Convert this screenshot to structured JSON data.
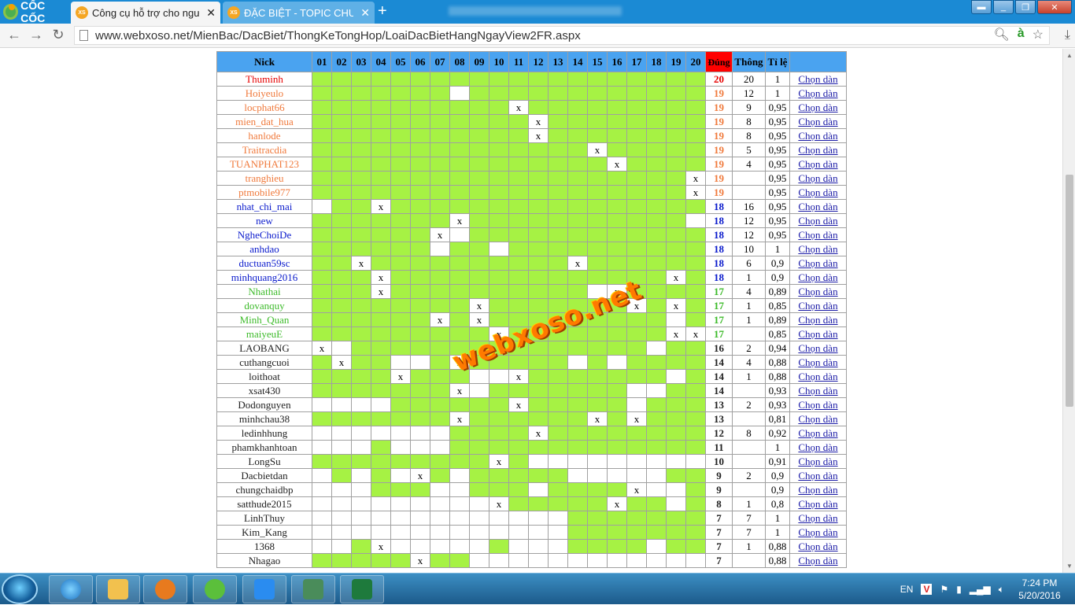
{
  "browser": {
    "name": "CỐC CỐC",
    "tabs": [
      {
        "title": "Công cụ hỗ trợ cho người",
        "icon": "XS",
        "active": true
      },
      {
        "title": "ĐẶC BIỆT - TOPIC CHUYÊN",
        "icon": "XS",
        "active": false
      }
    ],
    "url": "www.webxoso.net/MienBac/DacBiet/ThongKeTongHop/LoaiDacBietHangNgayView2FR.aspx"
  },
  "table": {
    "headers": {
      "nick": "Nick",
      "days": [
        "01",
        "02",
        "03",
        "04",
        "05",
        "06",
        "07",
        "08",
        "09",
        "10",
        "11",
        "12",
        "13",
        "14",
        "15",
        "16",
        "17",
        "18",
        "19",
        "20"
      ],
      "dung": "Đúng",
      "thong": "Thông",
      "tile": "Tỉ lệ"
    },
    "link_label": "Chọn dàn",
    "rows": [
      {
        "nick": "Thuminh",
        "color": "red",
        "pattern": "GGGGGGGGGGGGGGGGGGGG",
        "dung": "20",
        "thong": "20",
        "tile": "1"
      },
      {
        "nick": "Hoiyeulo",
        "color": "orange",
        "pattern": "GGGGGGGWGGGGGGGGGGGG",
        "dung": "19",
        "thong": "12",
        "tile": "1"
      },
      {
        "nick": "locphat66",
        "color": "orange",
        "pattern": "GGGGGGGGGGXGGGGGGGGG",
        "dung": "19",
        "thong": "9",
        "tile": "0,95"
      },
      {
        "nick": "mien_dat_hua",
        "color": "orange",
        "pattern": "GGGGGGGGGGGXGGGGGGGG",
        "dung": "19",
        "thong": "8",
        "tile": "0,95"
      },
      {
        "nick": "hanlode",
        "color": "orange",
        "pattern": "GGGGGGGGGGGXGGGGGGGG",
        "dung": "19",
        "thong": "8",
        "tile": "0,95"
      },
      {
        "nick": "Traitracdia",
        "color": "orange",
        "pattern": "GGGGGGGGGGGGGGXGGGGG",
        "dung": "19",
        "thong": "5",
        "tile": "0,95"
      },
      {
        "nick": "TUANPHAT123",
        "color": "orange",
        "pattern": "GGGGGGGGGGGGGGGXGGGG",
        "dung": "19",
        "thong": "4",
        "tile": "0,95"
      },
      {
        "nick": "tranghieu",
        "color": "orange",
        "pattern": "GGGGGGGGGGGGGGGGGGGX",
        "dung": "19",
        "thong": "",
        "tile": "0,95"
      },
      {
        "nick": "ptmobile977",
        "color": "orange",
        "pattern": "GGGGGGGGGGGGGGGGGGGX",
        "dung": "19",
        "thong": "",
        "tile": "0,95"
      },
      {
        "nick": "nhat_chi_mai",
        "color": "blue",
        "pattern": "WGGXGGGGGGGGGGGGGGGG",
        "dung": "18",
        "thong": "16",
        "tile": "0,95"
      },
      {
        "nick": "new",
        "color": "blue",
        "pattern": "GGGGGGGXGGGGGGGGGGGW",
        "dung": "18",
        "thong": "12",
        "tile": "0,95"
      },
      {
        "nick": "NgheChoiDe",
        "color": "blue",
        "pattern": "GGGGGGXWGGGGGGGGGGGG",
        "dung": "18",
        "thong": "12",
        "tile": "0,95"
      },
      {
        "nick": "anhdao",
        "color": "blue",
        "pattern": "GGGGGGWGGWGGGGGGGGGG",
        "dung": "18",
        "thong": "10",
        "tile": "1"
      },
      {
        "nick": "ductuan59sc",
        "color": "blue",
        "pattern": "GGXGGGGGGGGGGXGGGGGG",
        "dung": "18",
        "thong": "6",
        "tile": "0,9"
      },
      {
        "nick": "minhquang2016",
        "color": "blue",
        "pattern": "GGGXGGGGGGGGGGGGGGXG",
        "dung": "18",
        "thong": "1",
        "tile": "0,9"
      },
      {
        "nick": "Nhathai",
        "color": "green",
        "pattern": "GGGXGGGGGGGGGGWXGGGG",
        "dung": "17",
        "thong": "4",
        "tile": "0,89"
      },
      {
        "nick": "dovanquy",
        "color": "green",
        "pattern": "GGGGGGGGXGGGGGGGXGXG",
        "dung": "17",
        "thong": "1",
        "tile": "0,85"
      },
      {
        "nick": "Minh_Quan",
        "color": "green",
        "pattern": "GGGGGGXGXGGGGGGGGGWG",
        "dung": "17",
        "thong": "1",
        "tile": "0,89"
      },
      {
        "nick": "maiyeuE",
        "color": "green",
        "pattern": "GGGGGGGGGXGGGGGGGGXX",
        "dung": "17",
        "thong": "",
        "tile": "0,85"
      },
      {
        "nick": "LAOBANG",
        "color": "black",
        "pattern": "XWGGGGGGGGGGGGGGGWGG",
        "dung": "16",
        "thong": "2",
        "tile": "0,94"
      },
      {
        "nick": "cuthangcuoi",
        "color": "black",
        "pattern": "GXGGWWGXGGGGGWGWGGGG",
        "dung": "14",
        "thong": "4",
        "tile": "0,88"
      },
      {
        "nick": "loithoat",
        "color": "black",
        "pattern": "GGGGXGGGWWXGGGGGGGWG",
        "dung": "14",
        "thong": "1",
        "tile": "0,88"
      },
      {
        "nick": "xsat430",
        "color": "black",
        "pattern": "GGGGGGGXWGGGGGGGWWGG",
        "dung": "14",
        "thong": "",
        "tile": "0,93"
      },
      {
        "nick": "Dodonguyen",
        "color": "black",
        "pattern": "WWWWGGGGGGXGGGGGWGGG",
        "dung": "13",
        "thong": "2",
        "tile": "0,93"
      },
      {
        "nick": "minhchau38",
        "color": "black",
        "pattern": "GGGGGGGXGGGGGGXGXGGG",
        "dung": "13",
        "thong": "",
        "tile": "0,81"
      },
      {
        "nick": "ledinhhung",
        "color": "black",
        "pattern": "WWWWWWWGGGGXGGGGGGGG",
        "dung": "12",
        "thong": "8",
        "tile": "0,92"
      },
      {
        "nick": "phamkhanhtoan",
        "color": "black",
        "pattern": "WWWGWWWGGGGGGGGGGGGG",
        "dung": "11",
        "thong": "",
        "tile": "1"
      },
      {
        "nick": "LongSu",
        "color": "black",
        "pattern": "GGGGGGGGGXGWWWWWWWWW",
        "dung": "10",
        "thong": "",
        "tile": "0,91"
      },
      {
        "nick": "Dacbietdan",
        "color": "black",
        "pattern": "WGWGWXGWGGGGGWWWWWGG",
        "dung": "9",
        "thong": "2",
        "tile": "0,9"
      },
      {
        "nick": "chungchaidbp",
        "color": "black",
        "pattern": "WWWGGGWWGGGWGGGGXWWG",
        "dung": "9",
        "thong": "",
        "tile": "0,9"
      },
      {
        "nick": "satthude2015",
        "color": "black",
        "pattern": "WWWWWWWWWXGGGGGXGGWG",
        "dung": "8",
        "thong": "1",
        "tile": "0,8"
      },
      {
        "nick": "LinhThuy",
        "color": "black",
        "pattern": "WWWWWWWWWWWWWGGGGGGG",
        "dung": "7",
        "thong": "7",
        "tile": "1"
      },
      {
        "nick": "Kim_Kang",
        "color": "black",
        "pattern": "WWWWWWWWWWWWWGGGGGGG",
        "dung": "7",
        "thong": "7",
        "tile": "1"
      },
      {
        "nick": "1368",
        "color": "black",
        "pattern": "WWGXWWWWWGWWWGGGGWGG",
        "dung": "7",
        "thong": "1",
        "tile": "0,88"
      },
      {
        "nick": "Nhagao",
        "color": "black",
        "pattern": "GGGGGXGGWWWWWWWWWWWW",
        "dung": "7",
        "thong": "",
        "tile": "0,88"
      }
    ]
  },
  "watermark": "webxoso.net",
  "taskbar": {
    "lang": "EN",
    "time": "7:24 PM",
    "date": "5/20/2016"
  }
}
